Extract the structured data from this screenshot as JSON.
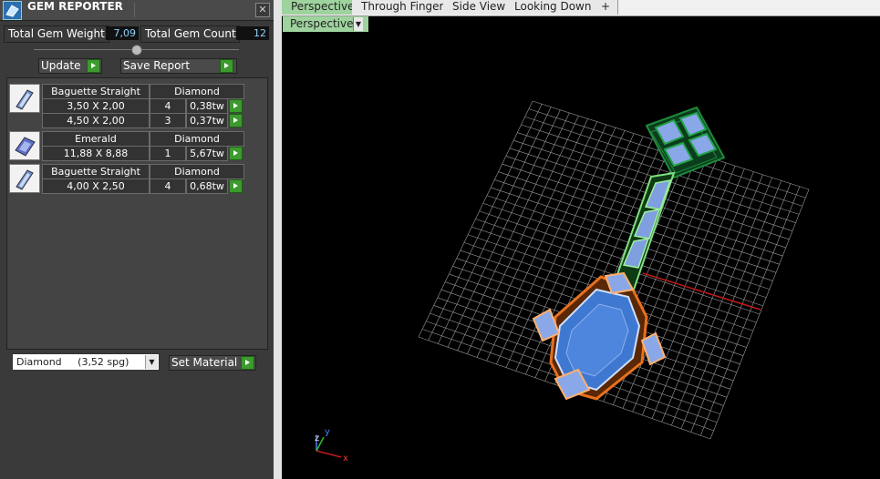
{
  "panel": {
    "title": "GEM REPORTER",
    "close_glyph": "✕",
    "total_weight_label": "Total Gem Weight",
    "total_weight_value": "7,09",
    "total_count_label": "Total Gem Count",
    "total_count_value": "12",
    "update_label": "Update",
    "save_report_label": "Save Report",
    "groups": [
      {
        "icon": "baguette-gem-icon",
        "cut": "Baguette Straight",
        "material": "Diamond",
        "rows": [
          {
            "size": "3,50 X 2,00",
            "count": "4",
            "weight": "0,38tw"
          },
          {
            "size": "4,50 X 2,00",
            "count": "3",
            "weight": "0,37tw"
          }
        ]
      },
      {
        "icon": "emerald-gem-icon",
        "cut": "Emerald",
        "material": "Diamond",
        "rows": [
          {
            "size": "11,88 X 8,88",
            "count": "1",
            "weight": "5,67tw"
          }
        ]
      },
      {
        "icon": "baguette-gem-icon",
        "cut": "Baguette Straight",
        "material": "Diamond",
        "rows": [
          {
            "size": "4,00 X 2,50",
            "count": "4",
            "weight": "0,68tw"
          }
        ]
      }
    ],
    "material_select_value": "Diamond     (3,52 spg)",
    "set_material_label": "Set Material"
  },
  "viewport": {
    "tabs": [
      {
        "label": "Perspective",
        "active": true
      },
      {
        "label": "Through Finger",
        "active": false
      },
      {
        "label": "Side View",
        "active": false
      },
      {
        "label": "Looking Down",
        "active": false
      },
      {
        "label": "+",
        "active": false
      }
    ],
    "view_dropdown_label": "Perspective",
    "axis_labels": {
      "x": "x",
      "y": "y",
      "z": "z"
    }
  },
  "colors": {
    "accent_green": "#9ed39e",
    "go_button": "#3c9a2e",
    "grid": "#9a9a9a",
    "center_gem": "#3f78d0",
    "setting_orange": "#e8701f",
    "shank_green": "#7fe07f",
    "halo_green": "#1e8a3c",
    "axis_red": "#c01a1a"
  }
}
